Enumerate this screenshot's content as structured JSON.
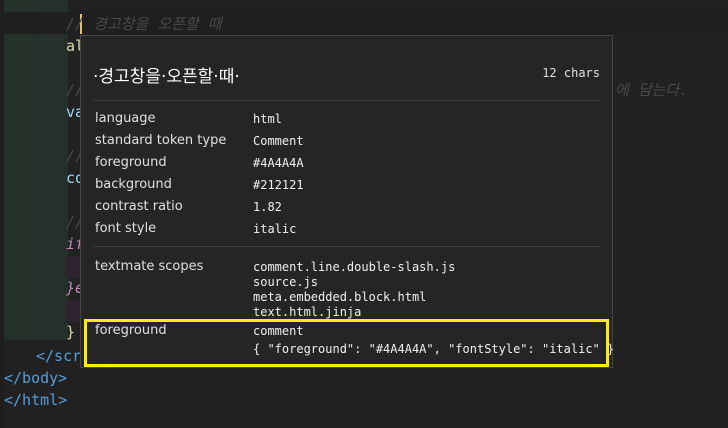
{
  "editor": {
    "line1_comment": "// 경고창을 오픈할 때",
    "line2": "al",
    "line3_comment": "//",
    "line4": "va",
    "line5_comment": "//",
    "line6": "co",
    "line7_comment": "//",
    "line8": "if",
    "line9": "}e",
    "line10": "}",
    "line11": "</scri",
    "line12": "</body>",
    "line13": "</html>",
    "right_overflow_comment": "에 담는다."
  },
  "hover": {
    "title": "·경고창을·오픈할·때·",
    "char_count": "12 chars",
    "rows": [
      {
        "label": "language",
        "value": "html"
      },
      {
        "label": "standard token type",
        "value": "Comment"
      },
      {
        "label": "foreground",
        "value": "#4A4A4A"
      },
      {
        "label": "background",
        "value": "#212121"
      },
      {
        "label": "contrast ratio",
        "value": "1.82"
      },
      {
        "label": "font style",
        "value": "italic"
      }
    ],
    "scopes_label": "textmate scopes",
    "scopes": [
      "comment.line.double-slash.js",
      "source.js",
      "meta.embedded.block.html",
      "text.html.jinja"
    ],
    "rule_label": "foreground",
    "rule_name": "comment",
    "rule_json": "{ \"foreground\": \"#4A4A4A\", \"fontStyle\": \"italic\" }"
  },
  "colors": {
    "background": "#212121",
    "comment_foreground": "#4A4A4A",
    "highlight_box": "#ffee00"
  }
}
